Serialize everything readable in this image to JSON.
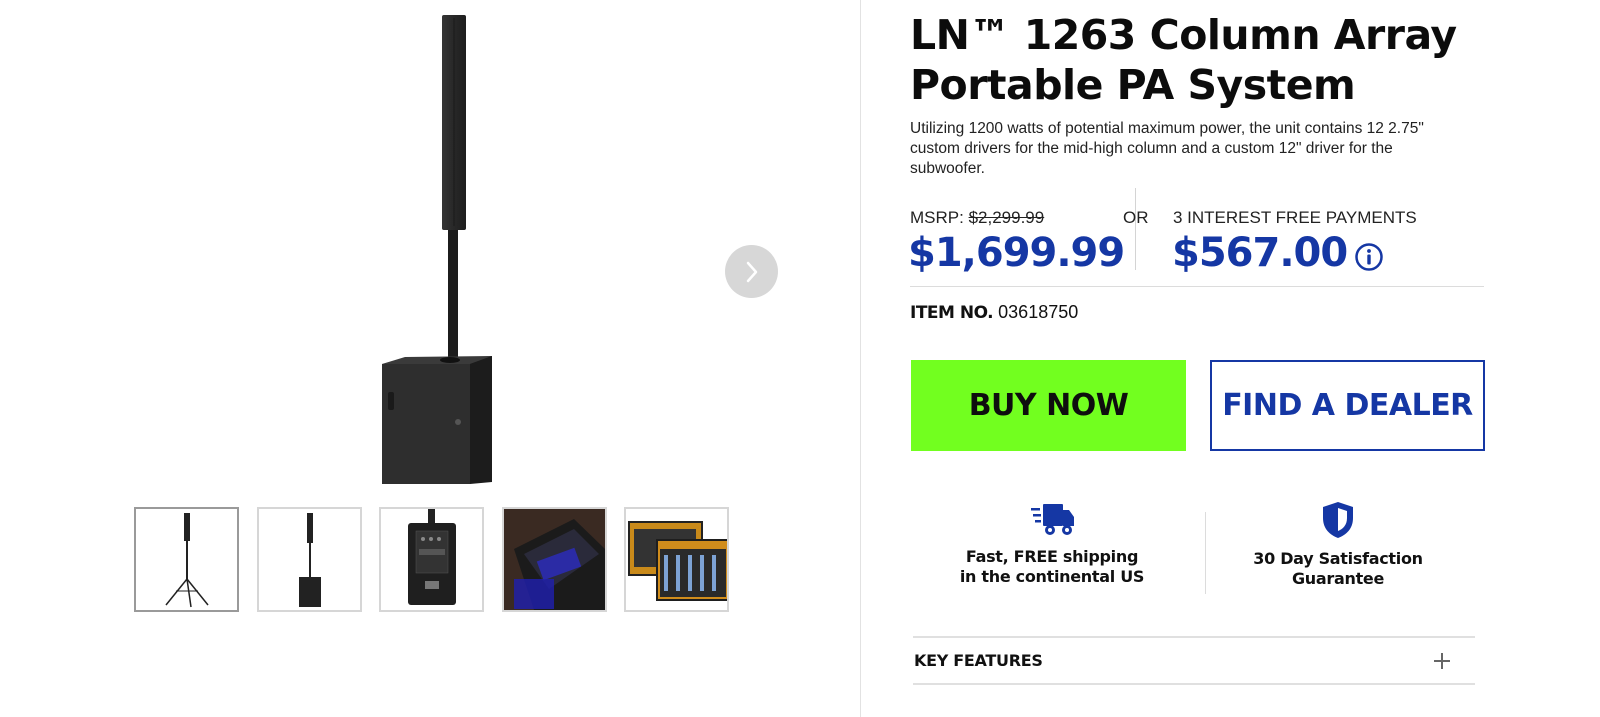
{
  "product": {
    "title": "LN™ 1263  Column Array Portable PA System",
    "description": "Utilizing 1200 watts of potential maximum power, the unit contains 12 2.75\" custom drivers for the mid-high column and a custom 12\" driver for the subwoofer.",
    "msrp_label": "MSRP:",
    "msrp_price": "$2,299.99",
    "price": "$1,699.99",
    "or_label": "OR",
    "payments_label": "3 INTEREST FREE PAYMENTS",
    "payment_amount": "$567.00",
    "item_no_label": "ITEM NO.",
    "item_no_value": "03618750"
  },
  "actions": {
    "buy_now": "BUY NOW",
    "find_dealer": "FIND A DEALER"
  },
  "badges": {
    "shipping": "Fast, FREE shipping\nin the continental US",
    "guarantee": "30 Day Satisfaction\nGuarantee"
  },
  "accordion": {
    "key_features": "KEY FEATURES"
  },
  "icons": {
    "next": "chevron-right-icon",
    "info": "info-icon",
    "shipping": "truck-icon",
    "guarantee": "shield-icon",
    "expand": "plus-icon"
  },
  "colors": {
    "price_blue": "#1537a4",
    "buy_green": "#72ff1f",
    "next_btn_bg": "#d7d7d7"
  }
}
